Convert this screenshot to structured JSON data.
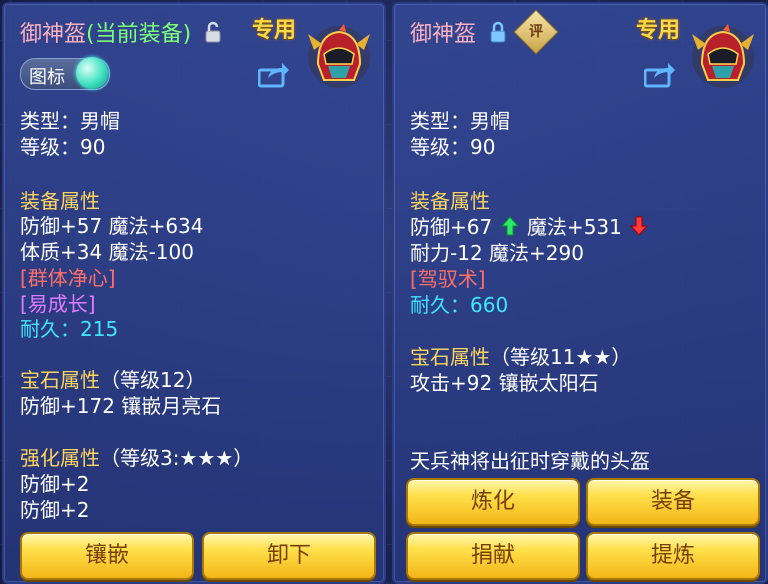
{
  "colors": {
    "panel": "#3a4e9e",
    "title_pink": "#ffb0c2",
    "equipped_green": "#7cff78",
    "attribute_gold": "#ffd45a",
    "skill_red": "#ff6e66",
    "trait_purple": "#e07cff",
    "durability_cyan": "#40e6ff",
    "button_gold": "#ffe04a"
  },
  "left": {
    "name": "御神盔",
    "equipped_tag": "(当前装备)",
    "lock_icon": "lock-open-icon",
    "special": "专用",
    "toggle_label": "图标",
    "type": "类型：男帽",
    "level": "等级：90",
    "attr_title": "装备属性",
    "attr_line1": "防御+57 魔法+634",
    "attr_line2": "体质+34 魔法-100",
    "skill1": "[群体净心]",
    "skill2": "[易成长]",
    "durability": "耐久：215",
    "gem_title": "宝石属性",
    "gem_level": "（等级12）",
    "gem_line": "防御+172 镶嵌月亮石",
    "enh_title": "强化属性",
    "enh_level": "（等级3:★★★）",
    "enh_line1": "防御+2",
    "enh_line2": "防御+2",
    "buttons": [
      "镶嵌",
      "卸下"
    ]
  },
  "right": {
    "name": "御神盔",
    "lock_icon": "lock-closed-icon",
    "appraise": "评",
    "special": "专用",
    "type": "类型：男帽",
    "level": "等级：90",
    "attr_title": "装备属性",
    "attr_def": "防御+67",
    "attr_magic": "魔法+531",
    "attr_line2": "耐力-12 魔法+290",
    "skill1": "[驾驭术]",
    "durability": "耐久：660",
    "gem_title": "宝石属性",
    "gem_level": "（等级11★★）",
    "gem_line": "攻击+92 镶嵌太阳石",
    "description": "天兵神将出征时穿戴的头盔",
    "buttons": [
      "炼化",
      "装备",
      "捐献",
      "提炼"
    ]
  }
}
